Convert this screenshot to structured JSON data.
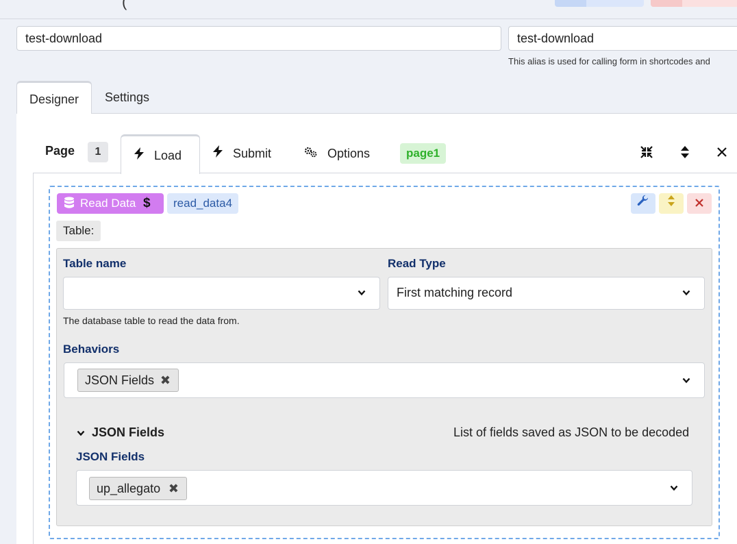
{
  "top": {
    "title_fragment": "("
  },
  "form": {
    "title_value": "test-download",
    "alias_value": "test-download",
    "alias_help": "This alias is used for calling form in shortcodes and"
  },
  "main_tabs": [
    {
      "label": "Designer"
    },
    {
      "label": "Settings"
    }
  ],
  "page_tabs": {
    "page_label": "Page",
    "page_number": "1",
    "load": "Load",
    "submit": "Submit",
    "options": "Options",
    "page_badge": "page1"
  },
  "block": {
    "type_label": "Read Data",
    "type_symbol": "$",
    "name": "read_data4",
    "section_tag": "Table:",
    "table_name_label": "Table name",
    "table_name_value": "",
    "table_help": "The database table to read the data from.",
    "read_type_label": "Read Type",
    "read_type_value": "First matching record",
    "behaviors_label": "Behaviors",
    "behaviors_chip": "JSON Fields",
    "json_section_title": "JSON Fields",
    "json_section_desc": "List of fields saved as JSON to be decoded",
    "json_fields_label": "JSON Fields",
    "json_fields_chip": "up_allegato"
  },
  "colors": {
    "read_badge": "#d27cf0",
    "name_badge": "#dce8fb",
    "page_badge_bg": "#d7f4d5",
    "page_badge_text": "#2fb12b",
    "label_text": "#12306b",
    "dashed_border": "#6fa8e8"
  },
  "icons": [
    "database-icon",
    "dollar-icon",
    "bolt-icon",
    "gears-icon",
    "collapse-icon",
    "sort-icon",
    "close-icon",
    "wrench-icon",
    "move-icon",
    "chevron-down-icon",
    "remove-icon"
  ]
}
